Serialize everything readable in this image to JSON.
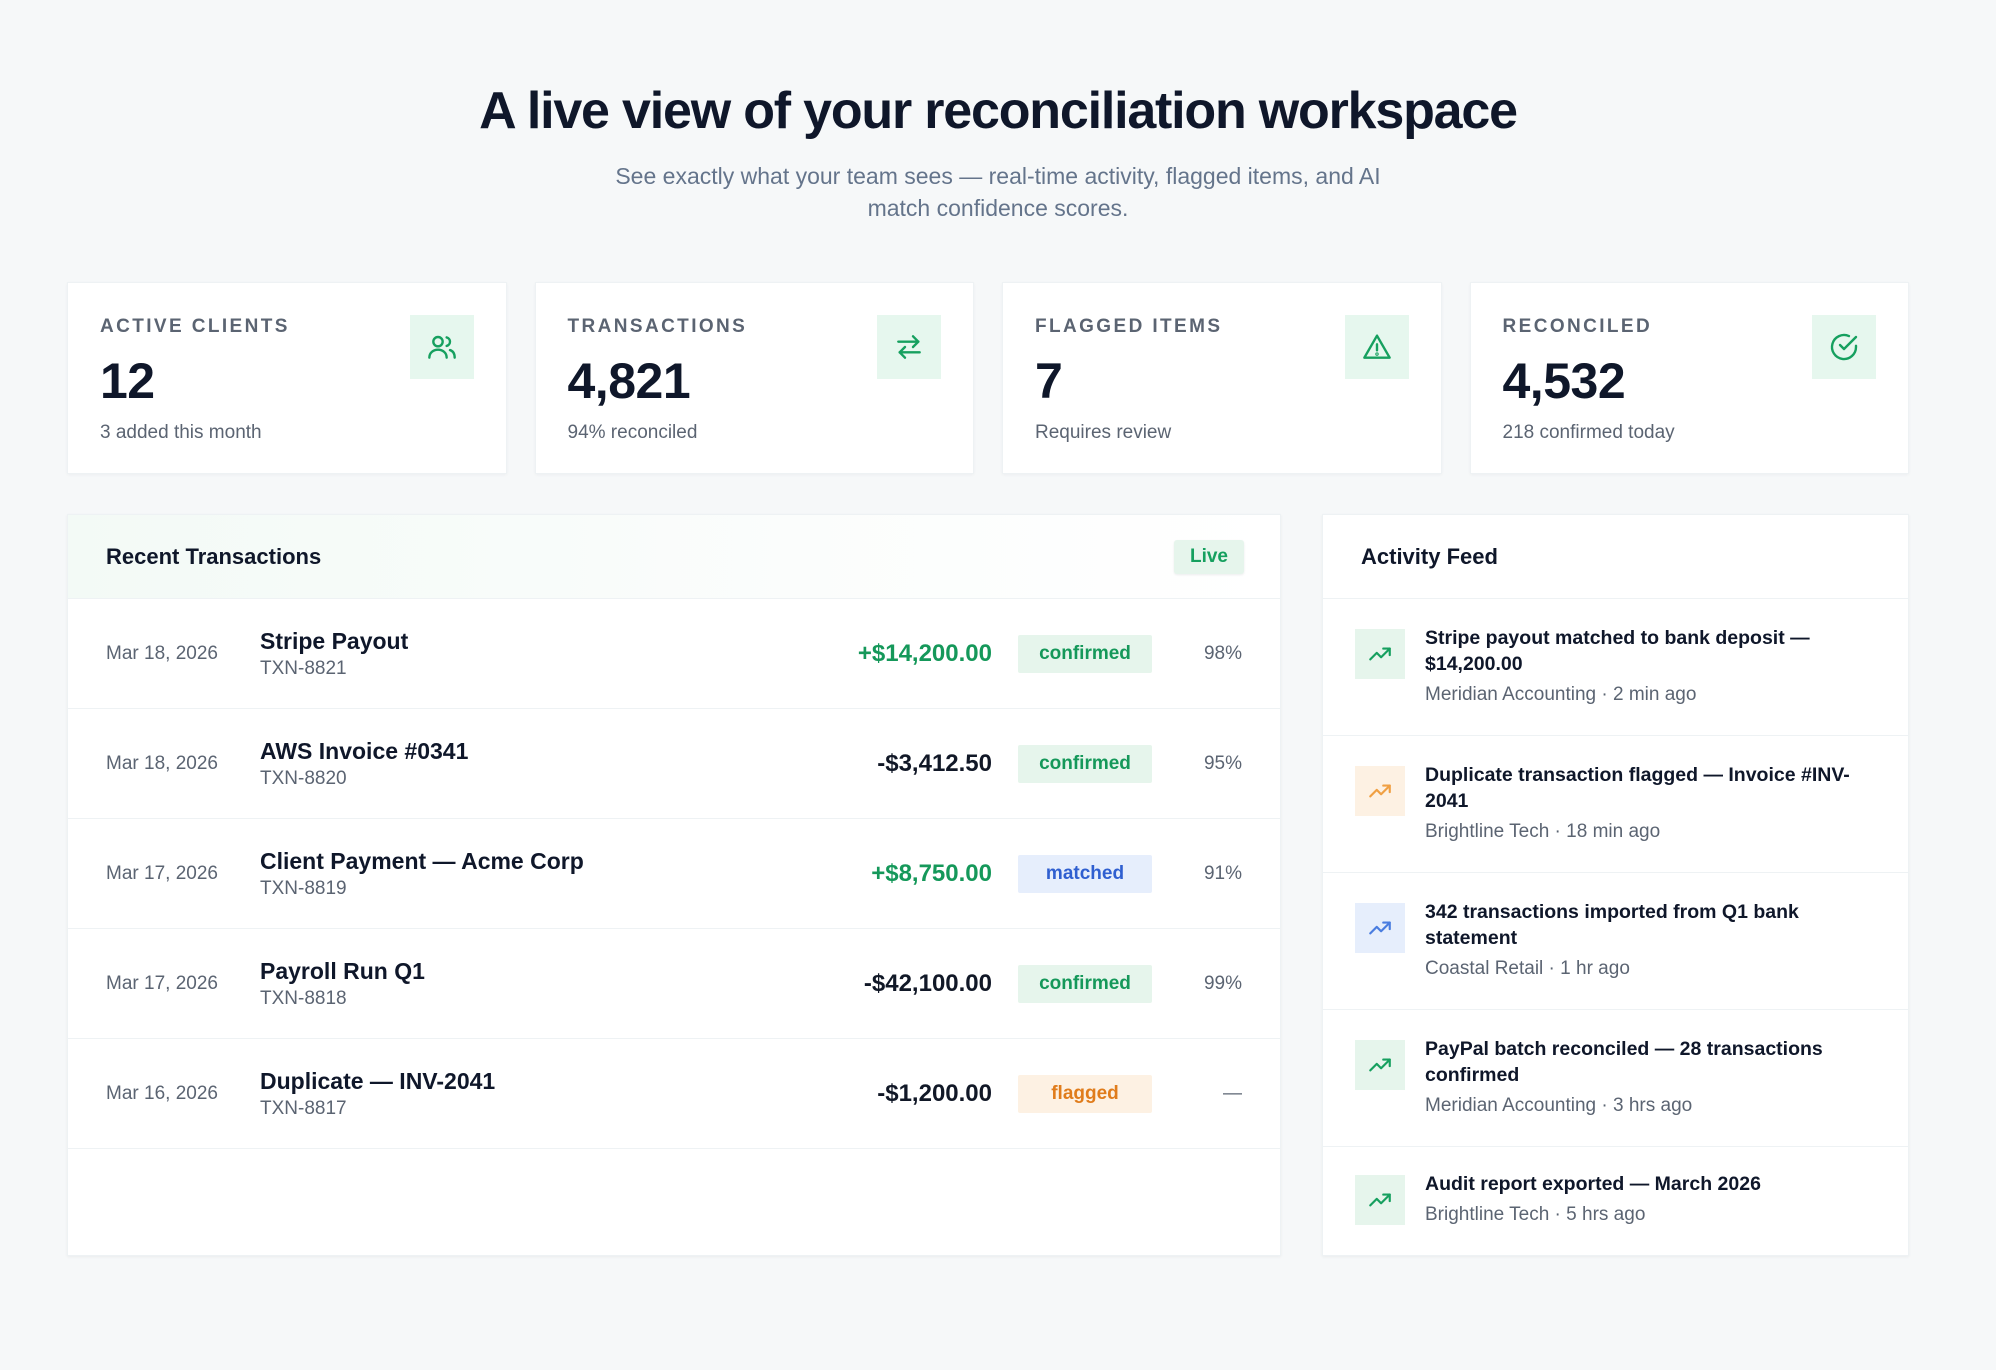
{
  "hero": {
    "title": "A live view of your reconciliation workspace",
    "subtitle": "See exactly what your team sees — real-time activity, flagged items, and AI match confidence scores."
  },
  "stats": [
    {
      "label": "ACTIVE CLIENTS",
      "value": "12",
      "sub": "3 added this month",
      "icon": "users-icon",
      "color": "#16a05f"
    },
    {
      "label": "TRANSACTIONS",
      "value": "4,821",
      "sub": "94% reconciled",
      "icon": "arrows-swap-icon",
      "color": "#16a05f"
    },
    {
      "label": "FLAGGED ITEMS",
      "value": "7",
      "sub": "Requires review",
      "icon": "alert-triangle-icon",
      "color": "#16a05f"
    },
    {
      "label": "RECONCILED",
      "value": "4,532",
      "sub": "218 confirmed today",
      "icon": "check-circle-icon",
      "color": "#16a05f"
    }
  ],
  "transactions": {
    "title": "Recent Transactions",
    "badge": "Live",
    "rows": [
      {
        "date": "Mar 18, 2026",
        "name": "Stripe Payout",
        "id": "TXN-8821",
        "amount": "+$14,200.00",
        "sign": "pos",
        "status": "confirmed",
        "confidence": "98%"
      },
      {
        "date": "Mar 18, 2026",
        "name": "AWS Invoice #0341",
        "id": "TXN-8820",
        "amount": "-$3,412.50",
        "sign": "neg",
        "status": "confirmed",
        "confidence": "95%"
      },
      {
        "date": "Mar 17, 2026",
        "name": "Client Payment — Acme Corp",
        "id": "TXN-8819",
        "amount": "+$8,750.00",
        "sign": "pos",
        "status": "matched",
        "confidence": "91%"
      },
      {
        "date": "Mar 17, 2026",
        "name": "Payroll Run Q1",
        "id": "TXN-8818",
        "amount": "-$42,100.00",
        "sign": "neg",
        "status": "confirmed",
        "confidence": "99%"
      },
      {
        "date": "Mar 16, 2026",
        "name": "Duplicate — INV-2041",
        "id": "TXN-8817",
        "amount": "-$1,200.00",
        "sign": "neg",
        "status": "flagged",
        "confidence": "—"
      }
    ]
  },
  "feed": {
    "title": "Activity Feed",
    "items": [
      {
        "title": "Stripe payout matched to bank deposit — $14,200.00",
        "meta": "Meridian Accounting · 2 min ago",
        "tone": "green",
        "icon": "trending-up-icon"
      },
      {
        "title": "Duplicate transaction flagged — Invoice #INV-2041",
        "meta": "Brightline Tech · 18 min ago",
        "tone": "orange",
        "icon": "trending-up-icon"
      },
      {
        "title": "342 transactions imported from Q1 bank statement",
        "meta": "Coastal Retail · 1 hr ago",
        "tone": "blue",
        "icon": "trending-up-icon"
      },
      {
        "title": "PayPal batch reconciled — 28 transactions confirmed",
        "meta": "Meridian Accounting · 3 hrs ago",
        "tone": "green",
        "icon": "trending-up-icon"
      },
      {
        "title": "Audit report exported — March 2026",
        "meta": "Brightline Tech · 5 hrs ago",
        "tone": "green",
        "icon": "trending-up-icon"
      }
    ]
  },
  "colors": {
    "green": "#16a05f",
    "orange": "#f0a043",
    "blue": "#4a7de0"
  }
}
